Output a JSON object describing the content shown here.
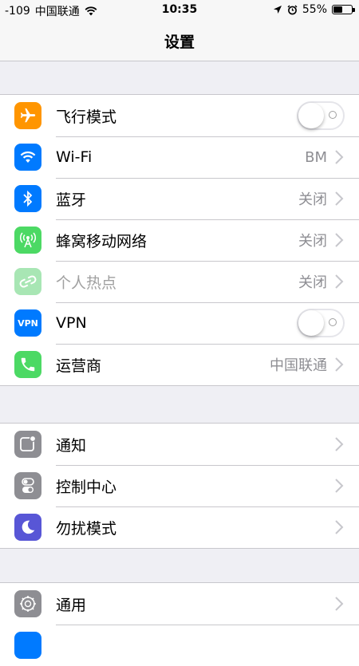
{
  "status_bar": {
    "signal": "-109",
    "carrier": "中国联通",
    "time": "10:35",
    "battery": "55%",
    "battery_level": 0.55
  },
  "nav": {
    "title": "设置"
  },
  "groups": [
    {
      "items": [
        {
          "label": "飞行模式",
          "icon": "airplane-icon",
          "control": "toggle",
          "on": false,
          "color": "#ff9500"
        },
        {
          "label": "Wi-Fi",
          "icon": "wifi-icon",
          "detail": "BM",
          "color": "#007aff"
        },
        {
          "label": "蓝牙",
          "icon": "bluetooth-icon",
          "detail": "关闭",
          "color": "#007aff"
        },
        {
          "label": "蜂窝移动网络",
          "icon": "cellular-icon",
          "detail": "关闭",
          "color": "#4cd964"
        },
        {
          "label": "个人热点",
          "icon": "hotspot-icon",
          "detail": "关闭",
          "color": "#a8e6b4",
          "disabled": true
        },
        {
          "label": "VPN",
          "icon": "vpn-icon",
          "icon_text": "VPN",
          "control": "toggle",
          "on": false,
          "color": "#007aff"
        },
        {
          "label": "运营商",
          "icon": "phone-icon",
          "detail": "中国联通",
          "color": "#4cd964"
        }
      ]
    },
    {
      "items": [
        {
          "label": "通知",
          "icon": "notifications-icon",
          "color": "#8e8e93"
        },
        {
          "label": "控制中心",
          "icon": "control-center-icon",
          "color": "#8e8e93"
        },
        {
          "label": "勿扰模式",
          "icon": "moon-icon",
          "color": "#5856d6"
        }
      ]
    },
    {
      "items": [
        {
          "label": "通用",
          "icon": "gear-icon",
          "color": "#8e8e93"
        }
      ]
    }
  ]
}
